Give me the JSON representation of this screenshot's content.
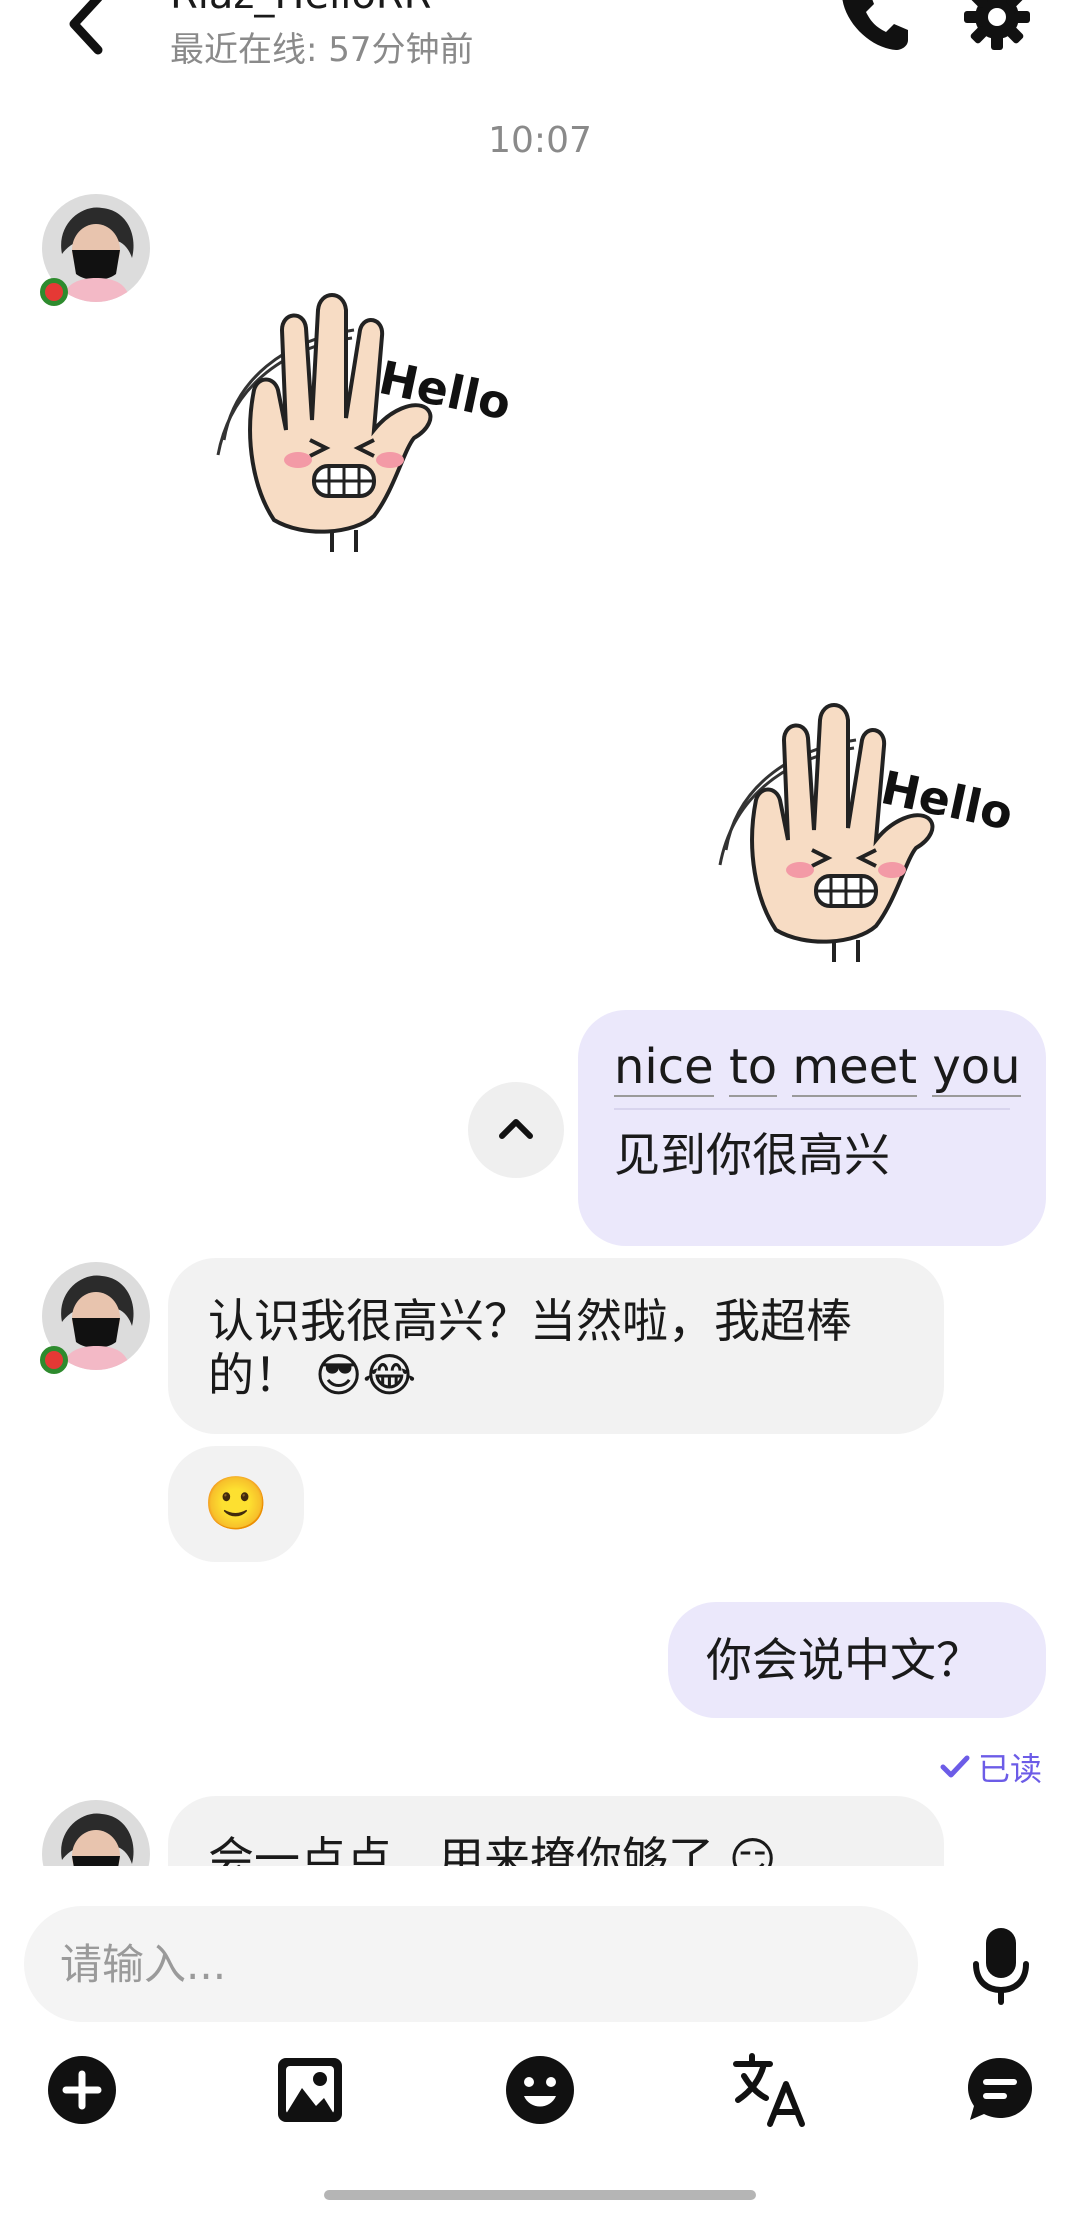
{
  "header": {
    "contact_name": "Riaz_HelloRR",
    "last_seen": "最近在线: 57分钟前"
  },
  "timestamp": "10:07",
  "messages": {
    "translated": {
      "words": [
        "nice",
        "to",
        "meet",
        "you"
      ],
      "translation": "见到你很高兴"
    },
    "reply_1": "认识我很高兴？当然啦，我超棒的！ 😎😂",
    "reply_2": "🙂",
    "outgoing_2": "你会说中文？",
    "read_status": "已读",
    "reply_3": "会一点点…用来撩你够了 😏"
  },
  "input": {
    "placeholder": "请输入..."
  },
  "colors": {
    "accent": "#6c5ce7",
    "outgoing_bubble": "#ebe8fb",
    "incoming_bubble": "#f2f2f2",
    "sticker_skin": "#f7dcc4"
  },
  "icons": {
    "back": "chevron-left-icon",
    "call": "phone-icon",
    "settings": "gear-icon",
    "collapse": "chevron-up-icon",
    "read": "checkmark-icon",
    "mic": "microphone-icon",
    "add": "plus-circle-icon",
    "image": "image-icon",
    "emoji": "smiley-icon",
    "translate": "translate-icon",
    "quick_reply": "chat-bubble-icon"
  },
  "sticker_text": "Hello"
}
